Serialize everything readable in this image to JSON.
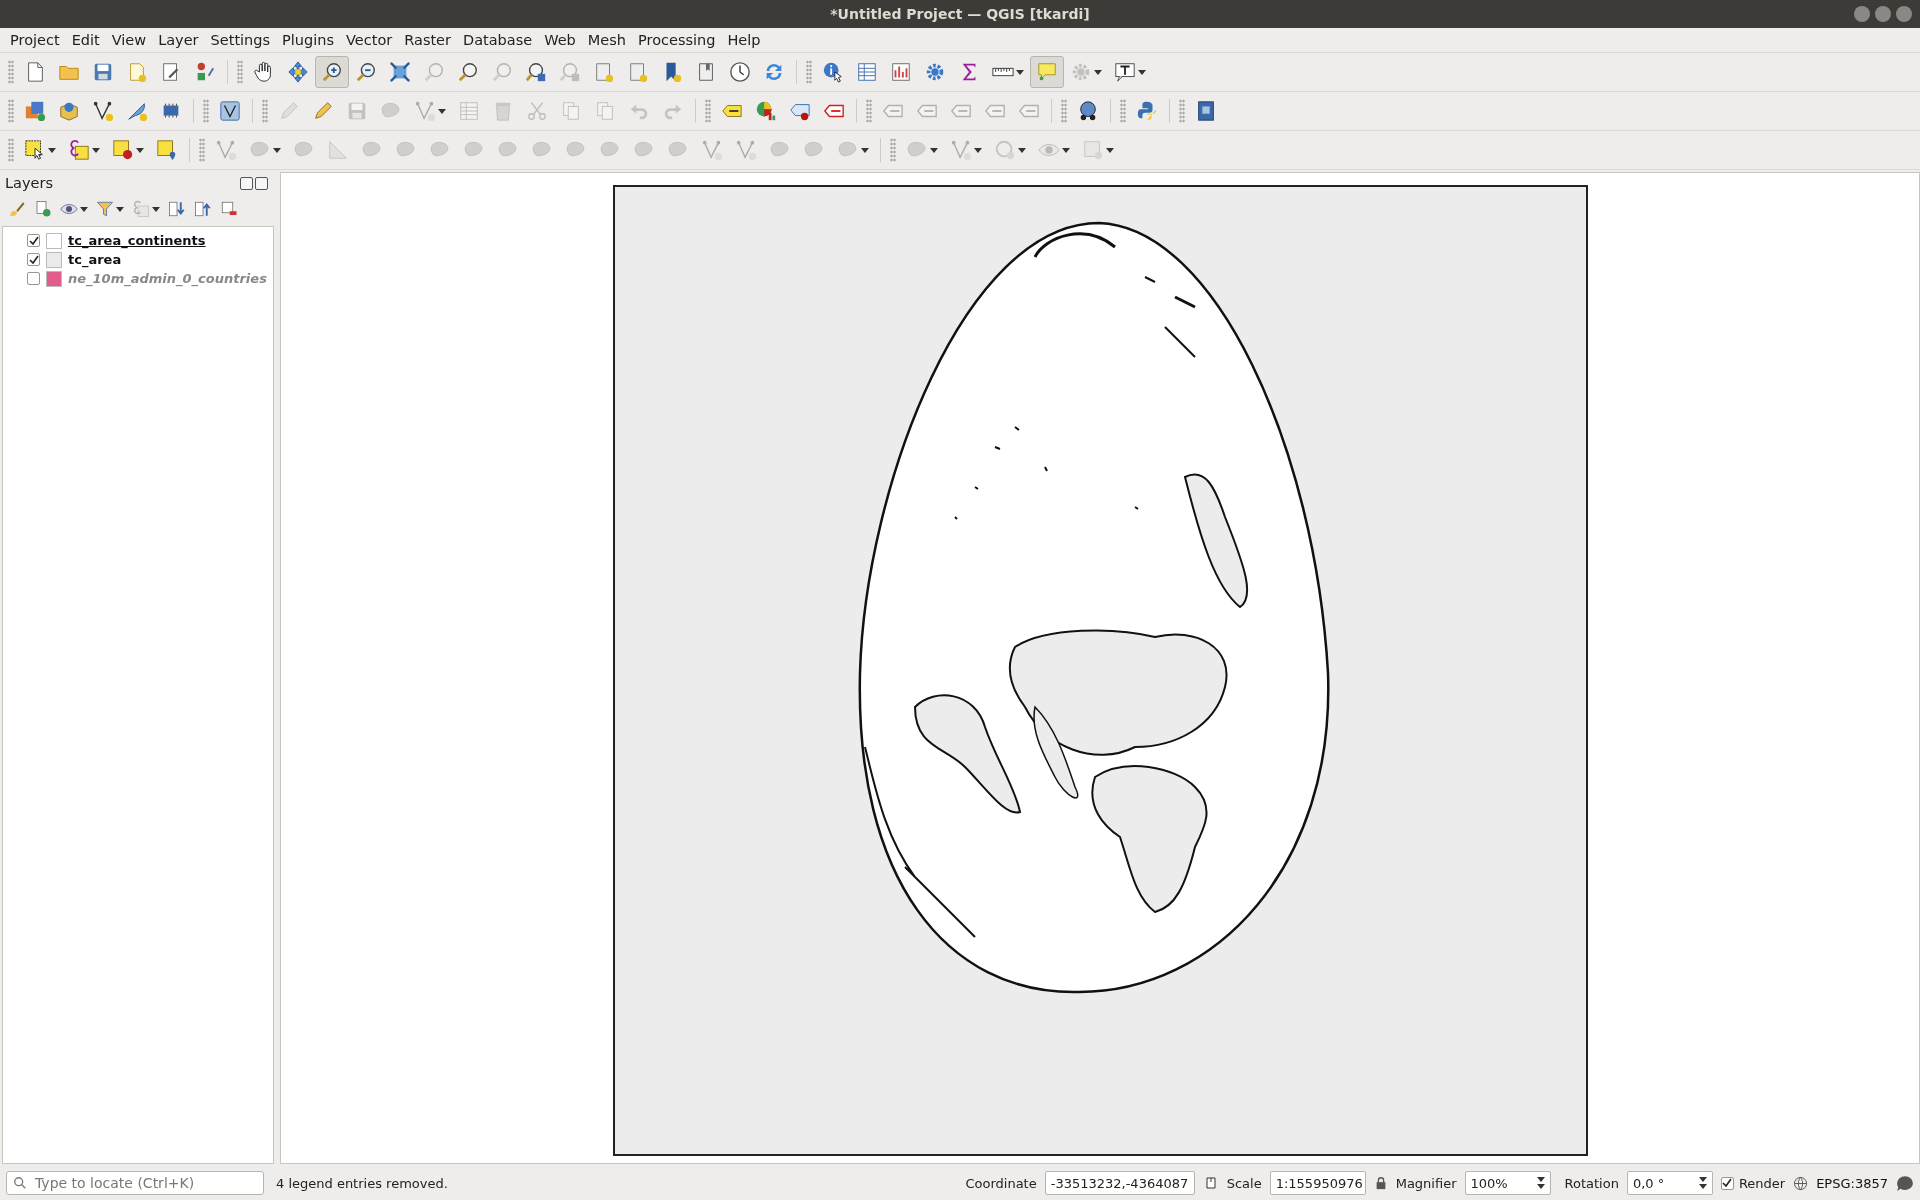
{
  "window": {
    "title": "*Untitled Project — QGIS [tkardi]"
  },
  "menu": [
    {
      "label": "Project"
    },
    {
      "label": "Edit"
    },
    {
      "label": "View"
    },
    {
      "label": "Layer"
    },
    {
      "label": "Settings"
    },
    {
      "label": "Plugins"
    },
    {
      "label": "Vector"
    },
    {
      "label": "Raster"
    },
    {
      "label": "Database"
    },
    {
      "label": "Web"
    },
    {
      "label": "Mesh"
    },
    {
      "label": "Processing"
    },
    {
      "label": "Help"
    }
  ],
  "toolbars": [
    {
      "items": [
        {
          "kind": "button",
          "disabled": false,
          "selected": false,
          "dropdown": false
        },
        {
          "kind": "button",
          "disabled": false,
          "selected": false,
          "dropdown": false
        },
        {
          "kind": "button",
          "disabled": false,
          "selected": false,
          "dropdown": false
        },
        {
          "kind": "button",
          "disabled": false,
          "selected": false,
          "dropdown": false
        },
        {
          "kind": "button",
          "disabled": false,
          "selected": false,
          "dropdown": false
        },
        {
          "kind": "button",
          "disabled": false,
          "selected": false,
          "dropdown": false
        },
        {
          "kind": "separator"
        },
        {
          "kind": "button",
          "disabled": false,
          "selected": false,
          "dropdown": false
        },
        {
          "kind": "button",
          "disabled": false,
          "selected": false,
          "dropdown": false
        },
        {
          "kind": "button",
          "disabled": false,
          "selected": true,
          "dropdown": false
        },
        {
          "kind": "button",
          "disabled": false,
          "selected": false,
          "dropdown": false
        },
        {
          "kind": "button",
          "disabled": false,
          "selected": false,
          "dropdown": false
        },
        {
          "kind": "button",
          "disabled": true,
          "selected": false,
          "dropdown": false
        },
        {
          "kind": "button",
          "disabled": false,
          "selected": false,
          "dropdown": false
        },
        {
          "kind": "button",
          "disabled": true,
          "selected": false,
          "dropdown": false
        },
        {
          "kind": "button",
          "disabled": false,
          "selected": false,
          "dropdown": false
        },
        {
          "kind": "button",
          "disabled": true,
          "selected": false,
          "dropdown": false
        },
        {
          "kind": "button",
          "disabled": false,
          "selected": false,
          "dropdown": false
        },
        {
          "kind": "button",
          "disabled": false,
          "selected": false,
          "dropdown": false
        },
        {
          "kind": "button",
          "disabled": false,
          "selected": false,
          "dropdown": false
        },
        {
          "kind": "button",
          "disabled": false,
          "selected": false,
          "dropdown": false
        },
        {
          "kind": "button",
          "disabled": false,
          "selected": false,
          "dropdown": false
        },
        {
          "kind": "button",
          "disabled": false,
          "selected": false,
          "dropdown": false
        },
        {
          "kind": "separator"
        },
        {
          "kind": "button",
          "disabled": false,
          "selected": false,
          "dropdown": false
        },
        {
          "kind": "button",
          "disabled": false,
          "selected": false,
          "dropdown": false
        },
        {
          "kind": "button",
          "disabled": false,
          "selected": false,
          "dropdown": false
        },
        {
          "kind": "button",
          "disabled": false,
          "selected": false,
          "dropdown": false
        },
        {
          "kind": "button",
          "disabled": false,
          "selected": false,
          "dropdown": false
        },
        {
          "kind": "button",
          "disabled": false,
          "selected": false,
          "dropdown": true
        },
        {
          "kind": "button",
          "disabled": false,
          "selected": true,
          "dropdown": false
        },
        {
          "kind": "button",
          "disabled": true,
          "selected": false,
          "dropdown": true
        },
        {
          "kind": "button",
          "disabled": false,
          "selected": false,
          "dropdown": true
        }
      ]
    },
    {
      "items": [
        {
          "kind": "button",
          "disabled": false,
          "selected": false,
          "dropdown": false
        },
        {
          "kind": "button",
          "disabled": false,
          "selected": false,
          "dropdown": false
        },
        {
          "kind": "button",
          "disabled": false,
          "selected": false,
          "dropdown": false
        },
        {
          "kind": "button",
          "disabled": false,
          "selected": false,
          "dropdown": false
        },
        {
          "kind": "button",
          "disabled": false,
          "selected": false,
          "dropdown": false
        },
        {
          "kind": "separator"
        },
        {
          "kind": "button",
          "disabled": false,
          "selected": false,
          "dropdown": false
        },
        {
          "kind": "separator"
        },
        {
          "kind": "button",
          "disabled": true,
          "selected": false,
          "dropdown": false
        },
        {
          "kind": "button",
          "disabled": false,
          "selected": false,
          "dropdown": false
        },
        {
          "kind": "button",
          "disabled": true,
          "selected": false,
          "dropdown": false
        },
        {
          "kind": "button",
          "disabled": true,
          "selected": false,
          "dropdown": false
        },
        {
          "kind": "button",
          "disabled": true,
          "selected": false,
          "dropdown": true
        },
        {
          "kind": "button",
          "disabled": true,
          "selected": false,
          "dropdown": false
        },
        {
          "kind": "button",
          "disabled": true,
          "selected": false,
          "dropdown": false
        },
        {
          "kind": "button",
          "disabled": true,
          "selected": false,
          "dropdown": false
        },
        {
          "kind": "button",
          "disabled": true,
          "selected": false,
          "dropdown": false
        },
        {
          "kind": "button",
          "disabled": true,
          "selected": false,
          "dropdown": false
        },
        {
          "kind": "button",
          "disabled": true,
          "selected": false,
          "dropdown": false
        },
        {
          "kind": "button",
          "disabled": true,
          "selected": false,
          "dropdown": false
        },
        {
          "kind": "separator"
        },
        {
          "kind": "button",
          "disabled": false,
          "selected": false,
          "dropdown": false
        },
        {
          "kind": "button",
          "disabled": false,
          "selected": false,
          "dropdown": false
        },
        {
          "kind": "button",
          "disabled": false,
          "selected": false,
          "dropdown": false
        },
        {
          "kind": "button",
          "disabled": false,
          "selected": false,
          "dropdown": false
        },
        {
          "kind": "separator"
        },
        {
          "kind": "button",
          "disabled": true,
          "selected": false,
          "dropdown": false
        },
        {
          "kind": "button",
          "disabled": true,
          "selected": false,
          "dropdown": false
        },
        {
          "kind": "button",
          "disabled": true,
          "selected": false,
          "dropdown": false
        },
        {
          "kind": "button",
          "disabled": true,
          "selected": false,
          "dropdown": false
        },
        {
          "kind": "button",
          "disabled": true,
          "selected": false,
          "dropdown": false
        },
        {
          "kind": "separator"
        },
        {
          "kind": "button",
          "disabled": false,
          "selected": false,
          "dropdown": false
        },
        {
          "kind": "separator"
        },
        {
          "kind": "button",
          "disabled": false,
          "selected": false,
          "dropdown": false
        },
        {
          "kind": "separator"
        },
        {
          "kind": "button",
          "disabled": false,
          "selected": false,
          "dropdown": false
        }
      ]
    },
    {
      "items": [
        {
          "kind": "button",
          "disabled": false,
          "selected": false,
          "dropdown": true
        },
        {
          "kind": "button",
          "disabled": false,
          "selected": false,
          "dropdown": true
        },
        {
          "kind": "button",
          "disabled": false,
          "selected": false,
          "dropdown": true
        },
        {
          "kind": "button",
          "disabled": false,
          "selected": false,
          "dropdown": false
        },
        {
          "kind": "separator"
        },
        {
          "kind": "button",
          "disabled": true,
          "selected": false,
          "dropdown": false
        },
        {
          "kind": "button",
          "disabled": true,
          "selected": false,
          "dropdown": true
        },
        {
          "kind": "button",
          "disabled": true,
          "selected": false,
          "dropdown": false
        },
        {
          "kind": "button",
          "disabled": true,
          "selected": false,
          "dropdown": false
        },
        {
          "kind": "button",
          "disabled": true,
          "selected": false,
          "dropdown": false
        },
        {
          "kind": "button",
          "disabled": true,
          "selected": false,
          "dropdown": false
        },
        {
          "kind": "button",
          "disabled": true,
          "selected": false,
          "dropdown": false
        },
        {
          "kind": "button",
          "disabled": true,
          "selected": false,
          "dropdown": false
        },
        {
          "kind": "button",
          "disabled": true,
          "selected": false,
          "dropdown": false
        },
        {
          "kind": "button",
          "disabled": true,
          "selected": false,
          "dropdown": false
        },
        {
          "kind": "button",
          "disabled": true,
          "selected": false,
          "dropdown": false
        },
        {
          "kind": "button",
          "disabled": true,
          "selected": false,
          "dropdown": false
        },
        {
          "kind": "button",
          "disabled": true,
          "selected": false,
          "dropdown": false
        },
        {
          "kind": "button",
          "disabled": true,
          "selected": false,
          "dropdown": false
        },
        {
          "kind": "button",
          "disabled": true,
          "selected": false,
          "dropdown": false
        },
        {
          "kind": "button",
          "disabled": true,
          "selected": false,
          "dropdown": false
        },
        {
          "kind": "button",
          "disabled": true,
          "selected": false,
          "dropdown": false
        },
        {
          "kind": "button",
          "disabled": true,
          "selected": false,
          "dropdown": false
        },
        {
          "kind": "button",
          "disabled": true,
          "selected": false,
          "dropdown": true
        },
        {
          "kind": "separator"
        },
        {
          "kind": "button",
          "disabled": true,
          "selected": false,
          "dropdown": true
        },
        {
          "kind": "button",
          "disabled": true,
          "selected": false,
          "dropdown": true
        },
        {
          "kind": "button",
          "disabled": true,
          "selected": false,
          "dropdown": true
        },
        {
          "kind": "button",
          "disabled": true,
          "selected": false,
          "dropdown": true
        },
        {
          "kind": "button",
          "disabled": true,
          "selected": false,
          "dropdown": true
        }
      ]
    }
  ],
  "layers_panel": {
    "title": "Layers",
    "toolbar": [
      {
        "disabled": false,
        "dropdown": false
      },
      {
        "disabled": false,
        "dropdown": false
      },
      {
        "disabled": false,
        "dropdown": true
      },
      {
        "disabled": false,
        "dropdown": true
      },
      {
        "disabled": true,
        "dropdown": true
      },
      {
        "disabled": false,
        "dropdown": false
      },
      {
        "disabled": false,
        "dropdown": false
      },
      {
        "disabled": false,
        "dropdown": false
      }
    ],
    "layers": [
      {
        "name": "tc_area_continents",
        "checked": true,
        "selected": true,
        "color": "#ffffff"
      },
      {
        "name": "tc_area",
        "checked": true,
        "selected": false,
        "color": "#ebebeb"
      },
      {
        "name": "ne_10m_admin_0_countries",
        "checked": false,
        "selected": false,
        "color": "#e25c8b"
      }
    ]
  },
  "status_bar": {
    "locator": {
      "placeholder": "Type to locate (Ctrl+K)"
    },
    "message": "4 legend entries removed.",
    "coordinate": {
      "label": "Coordinate",
      "value": "-33513232,-4364087"
    },
    "scale": {
      "label": "Scale",
      "value": "1:155950976"
    },
    "magnifier": {
      "label": "Magnifier",
      "value": "100%"
    },
    "rotation": {
      "label": "Rotation",
      "value": "0,0 °"
    },
    "render": {
      "label": "Render",
      "checked": true
    },
    "crs": "EPSG:3857"
  }
}
